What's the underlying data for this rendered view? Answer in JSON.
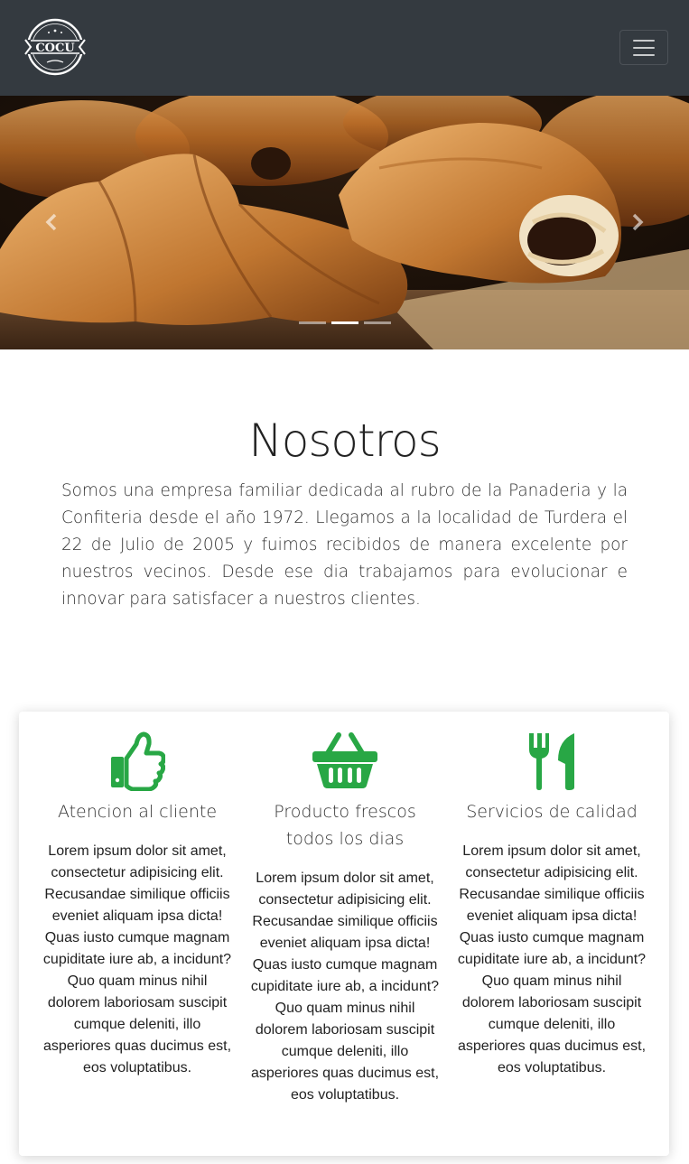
{
  "navbar": {
    "logo_text": "COCU",
    "logo_icon": "bakery-logo",
    "menu_icon": "hamburger-menu-icon"
  },
  "carousel": {
    "image": "croissants-and-pain-au-chocolat",
    "prev_icon": "chevron-left-icon",
    "next_icon": "chevron-right-icon",
    "slide_count": 3,
    "active_slide": 2
  },
  "about": {
    "title": "Nosotros",
    "text": "Somos una empresa familiar dedicada al rubro de la Panaderia y la Confiteria desde el año 1972. Llegamos a la localidad de Turdera el 22 de Julio de 2005 y fuimos recibidos de manera excelente por nuestros vecinos. Desde ese dia trabajamos para evolucionar e innovar para satisfacer a nuestros clientes."
  },
  "features": [
    {
      "icon": "thumbs-up-icon",
      "title": "Atencion al cliente",
      "text": "Lorem ipsum dolor sit amet, consectetur adipisicing elit. Recusandae similique officiis eveniet aliquam ipsa dicta! Quas iusto cumque magnam cupiditate iure ab, a incidunt? Quo quam minus nihil dolorem laboriosam suscipit cumque deleniti, illo asperiores quas ducimus est, eos voluptatibus."
    },
    {
      "icon": "shopping-basket-icon",
      "title": "Producto frescos todos los dias",
      "text": "Lorem ipsum dolor sit amet, consectetur adipisicing elit. Recusandae similique officiis eveniet aliquam ipsa dicta! Quas iusto cumque magnam cupiditate iure ab, a incidunt? Quo quam minus nihil dolorem laboriosam suscipit cumque deleniti, illo asperiores quas ducimus est, eos voluptatibus."
    },
    {
      "icon": "utensils-icon",
      "title": "Servicios de calidad",
      "text": "Lorem ipsum dolor sit amet, consectetur adipisicing elit. Recusandae similique officiis eveniet aliquam ipsa dicta! Quas iusto cumque magnam cupiditate iure ab, a incidunt? Quo quam minus nihil dolorem laboriosam suscipit cumque deleniti, illo asperiores quas ducimus est, eos voluptatibus."
    }
  ],
  "colors": {
    "navbar_bg": "#343a40",
    "icon_green": "#28a745",
    "text": "#222222"
  }
}
